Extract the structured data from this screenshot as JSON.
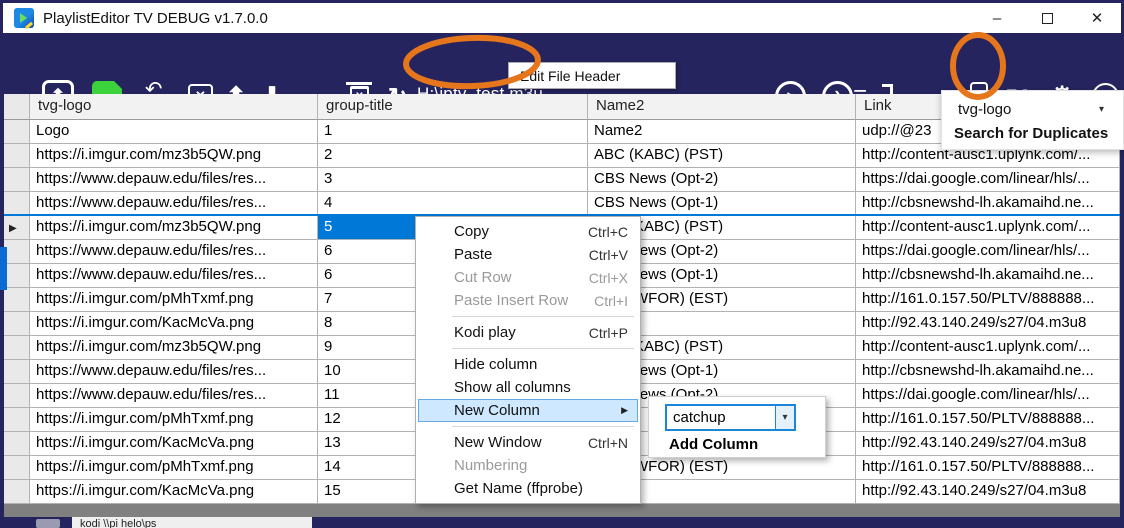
{
  "colors": {
    "toolbar_navy": "#26245e",
    "accent_blue": "#0078d7",
    "annotation_orange": "#e5761b",
    "save_green": "#3bd23b",
    "menu_highlight": "#cde8ff"
  },
  "titlebar": {
    "app_title": "PlaylistEditor TV DEBUG v1.7.0.0"
  },
  "toolbar": {
    "file_path": "H:\\iptv_test.m3u",
    "tooltip": "Edit File Header"
  },
  "duplicates_panel": {
    "column_value": "tvg-logo",
    "action_label": "Search for Duplicates"
  },
  "grid": {
    "columns": [
      "tvg-logo",
      "group-title",
      "Name2",
      "Link"
    ],
    "selected_row": 5,
    "selected_column": "group-title",
    "rows": [
      {
        "logo": "Logo",
        "group": "1",
        "name": "Name2",
        "link": "udp://@23"
      },
      {
        "logo": "https://i.imgur.com/mz3b5QW.png",
        "group": "2",
        "name": "ABC (KABC) (PST)",
        "link": "http://content-ausc1.uplynk.com/..."
      },
      {
        "logo": "https://www.depauw.edu/files/res...",
        "group": "3",
        "name": "CBS News (Opt-2)",
        "link": "https://dai.google.com/linear/hls/..."
      },
      {
        "logo": "https://www.depauw.edu/files/res...",
        "group": "4",
        "name": "CBS News (Opt-1)",
        "link": "http://cbsnewshd-lh.akamaihd.ne..."
      },
      {
        "logo": "https://i.imgur.com/mz3b5QW.png",
        "group": "5",
        "name": "ABC (KABC) (PST)",
        "link": "http://content-ausc1.uplynk.com/..."
      },
      {
        "logo": "https://www.depauw.edu/files/res...",
        "group": "6",
        "name": "CBS News (Opt-2)",
        "link": "https://dai.google.com/linear/hls/..."
      },
      {
        "logo": "https://www.depauw.edu/files/res...",
        "group": "6",
        "name": "CBS News (Opt-1)",
        "link": "http://cbsnewshd-lh.akamaihd.ne..."
      },
      {
        "logo": "https://i.imgur.com/pMhTxmf.png",
        "group": "7",
        "name": "CBS (WFOR) (EST)",
        "link": "http://161.0.157.50/PLTV/888888..."
      },
      {
        "logo": "https://i.imgur.com/KacMcVa.png",
        "group": "8",
        "name": "",
        "link": "http://92.43.140.249/s27/04.m3u8"
      },
      {
        "logo": "https://i.imgur.com/mz3b5QW.png",
        "group": "9",
        "name": "ABC (KABC) (PST)",
        "link": "http://content-ausc1.uplynk.com/..."
      },
      {
        "logo": "https://www.depauw.edu/files/res...",
        "group": "10",
        "name": "CBS News (Opt-1)",
        "link": "http://cbsnewshd-lh.akamaihd.ne..."
      },
      {
        "logo": "https://www.depauw.edu/files/res...",
        "group": "11",
        "name": "CBS News (Opt-2)",
        "link": "https://dai.google.com/linear/hls/..."
      },
      {
        "logo": "https://i.imgur.com/pMhTxmf.png",
        "group": "12",
        "name": "",
        "link": "http://161.0.157.50/PLTV/888888..."
      },
      {
        "logo": "https://i.imgur.com/KacMcVa.png",
        "group": "13",
        "name": "",
        "link": "http://92.43.140.249/s27/04.m3u8"
      },
      {
        "logo": "https://i.imgur.com/pMhTxmf.png",
        "group": "14",
        "name": "CBS (WFOR) (EST)",
        "link": "http://161.0.157.50/PLTV/888888..."
      },
      {
        "logo": "https://i.imgur.com/KacMcVa.png",
        "group": "15",
        "name": "",
        "link": "http://92.43.140.249/s27/04.m3u8"
      }
    ]
  },
  "context_menu": {
    "items": [
      {
        "label": "Copy",
        "shortcut": "Ctrl+C"
      },
      {
        "label": "Paste",
        "shortcut": "Ctrl+V"
      },
      {
        "label": "Cut Row",
        "shortcut": "Ctrl+X",
        "disabled": true
      },
      {
        "label": "Paste Insert Row",
        "shortcut": "Ctrl+I",
        "disabled": true
      },
      {
        "separator": true
      },
      {
        "label": "Kodi play",
        "shortcut": "Ctrl+P"
      },
      {
        "separator": true
      },
      {
        "label": "Hide column"
      },
      {
        "label": "Show all columns"
      },
      {
        "label": "New Column",
        "submenu": true,
        "highlighted": true
      },
      {
        "separator": true
      },
      {
        "label": "New Window",
        "shortcut": "Ctrl+N"
      },
      {
        "label": "Numbering",
        "disabled": true
      },
      {
        "label": "Get Name (ffprobe)"
      }
    ]
  },
  "new_column_submenu": {
    "combo_value": "catchup",
    "button_label": "Add Column"
  },
  "status_strip": {
    "partial_text": "kodi \\\\pi helo\\ps"
  },
  "glyphs": {
    "minimize": "–",
    "close": "✕",
    "open_arrow": "⬆",
    "undo": "↶",
    "redo": "↷",
    "clear_x": "✕",
    "up": "⬆",
    "down": "⬇",
    "menu_lines": "≡",
    "plus": "+",
    "trash_x": "✕",
    "refresh": "↻",
    "play": "▶",
    "chevron": "›",
    "import_arrow": "→",
    "check": "✔",
    "dup_arrow": "↳",
    "eq": "EQ",
    "gear": "⚙",
    "info": "i",
    "row_current": "▶",
    "combo_arrow": "▾",
    "submenu_arrow": "▶"
  }
}
